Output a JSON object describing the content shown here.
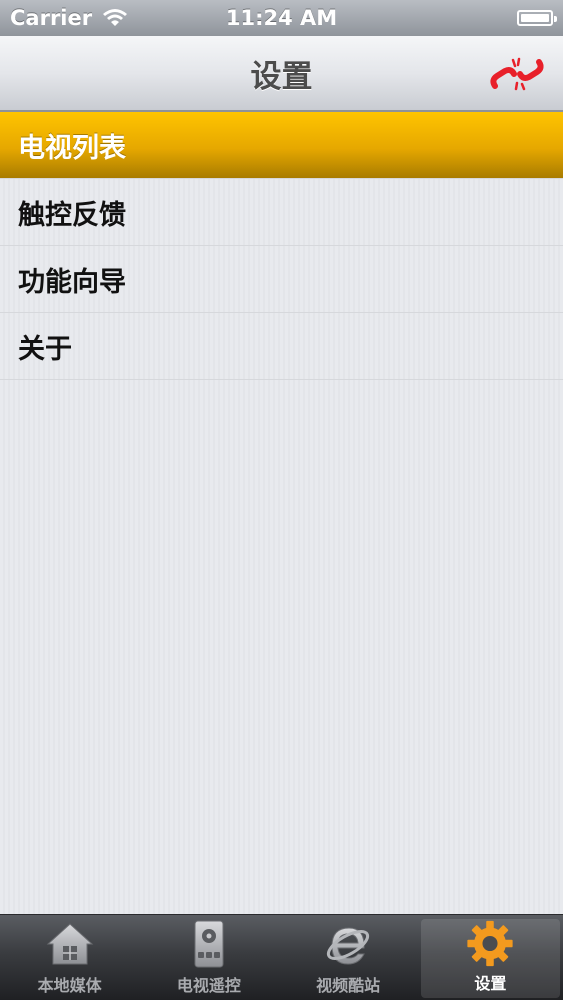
{
  "status_bar": {
    "carrier": "Carrier",
    "time": "11:24 AM",
    "battery_level": 1.0
  },
  "nav_bar": {
    "title": "设置",
    "action_icon": "broken-link-icon"
  },
  "settings_list": {
    "items": [
      {
        "label": "电视列表",
        "selected": true
      },
      {
        "label": "触控反馈",
        "selected": false
      },
      {
        "label": "功能向导",
        "selected": false
      },
      {
        "label": "关于",
        "selected": false
      }
    ]
  },
  "tab_bar": {
    "tabs": [
      {
        "label": "本地媒体",
        "icon": "home-icon",
        "active": false
      },
      {
        "label": "电视遥控",
        "icon": "remote-icon",
        "active": false
      },
      {
        "label": "视频酷站",
        "icon": "browser-e-icon",
        "active": false
      },
      {
        "label": "设置",
        "icon": "gear-icon",
        "active": true
      }
    ]
  },
  "colors": {
    "selected_row": "#f0b400",
    "tab_active_icon": "#f39a1e",
    "broken_link_red": "#e8202a"
  }
}
